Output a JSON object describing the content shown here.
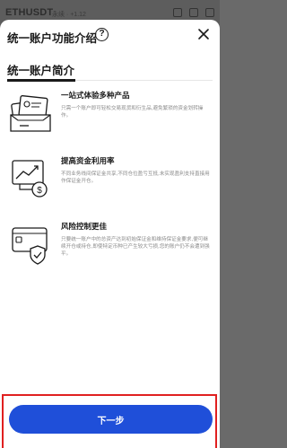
{
  "background": {
    "symbol": "ETHUSDT",
    "sub": "永续 · +1.12"
  },
  "modal": {
    "title": "统一账户功能介绍",
    "help_icon_glyph": "?",
    "close_icon": "close-icon"
  },
  "section": {
    "title": "统一账户简介"
  },
  "features": [
    {
      "title": "一站式体验多种产品",
      "desc": "只需一个账户即可轻松交易现货和衍生品,避免繁琐的资金划转操作。",
      "icon": "wallet-cards-icon"
    },
    {
      "title": "提高资金利用率",
      "desc": "不同业务线间保证金共享,不同仓位盈亏互抵,未实现盈利支持直接用作保证金开仓。",
      "icon": "growth-chart-icon"
    },
    {
      "title": "风险控制更佳",
      "desc": "只要统一账户中的总资产达到初始保证金和维持保证金要求,便可继续开仓或持仓,即使特定币种已产生较大亏损,您的账户仍不会遭到强平。",
      "icon": "shield-wallet-icon"
    }
  ],
  "footer": {
    "next_label": "下一步"
  },
  "colors": {
    "accent": "#1f4fd9",
    "highlight": "#e02020"
  }
}
